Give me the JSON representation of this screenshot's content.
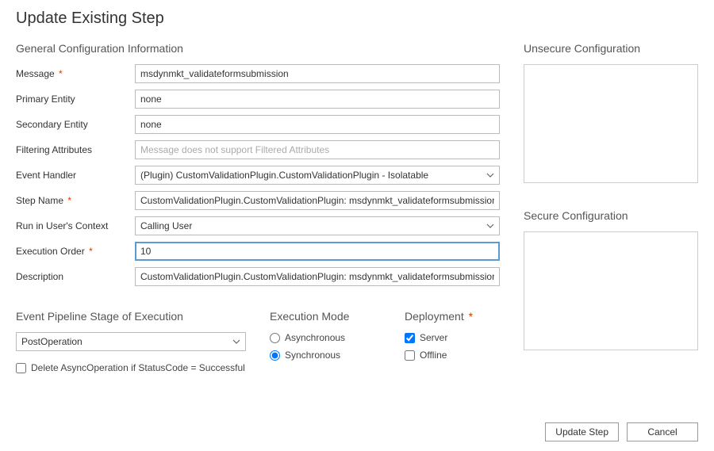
{
  "pageTitle": "Update Existing Step",
  "sections": {
    "general": "General Configuration Information",
    "pipeline": "Event Pipeline Stage of Execution",
    "execMode": "Execution Mode",
    "deployment": "Deployment",
    "unsecure": "Unsecure  Configuration",
    "secure": "Secure  Configuration"
  },
  "labels": {
    "message": "Message",
    "primaryEntity": "Primary Entity",
    "secondaryEntity": "Secondary Entity",
    "filteringAttributes": "Filtering Attributes",
    "eventHandler": "Event Handler",
    "stepName": "Step Name",
    "runInUsersContext": "Run in User's Context",
    "executionOrder": "Execution Order",
    "description": "Description",
    "asynchronous": "Asynchronous",
    "synchronous": "Synchronous",
    "server": "Server",
    "offline": "Offline",
    "deleteAsync": "Delete AsyncOperation if StatusCode = Successful"
  },
  "values": {
    "message": "msdynmkt_validateformsubmission",
    "primaryEntity": "none",
    "secondaryEntity": "none",
    "filteringAttributesPlaceholder": "Message does not support Filtered Attributes",
    "eventHandler": "(Plugin) CustomValidationPlugin.CustomValidationPlugin - Isolatable",
    "stepName": "CustomValidationPlugin.CustomValidationPlugin: msdynmkt_validateformsubmission of any Entity",
    "runInUsersContext": "Calling User",
    "executionOrder": "10",
    "description": "CustomValidationPlugin.CustomValidationPlugin: msdynmkt_validateformsubmission of any Entity",
    "pipelineStage": "PostOperation",
    "execModeSelected": "synchronous",
    "serverChecked": true,
    "offlineChecked": false,
    "deleteAsyncChecked": false,
    "unsecureConfig": "",
    "secureConfig": ""
  },
  "requiredMarker": "*",
  "buttons": {
    "updateStep": "Update Step",
    "cancel": "Cancel"
  }
}
